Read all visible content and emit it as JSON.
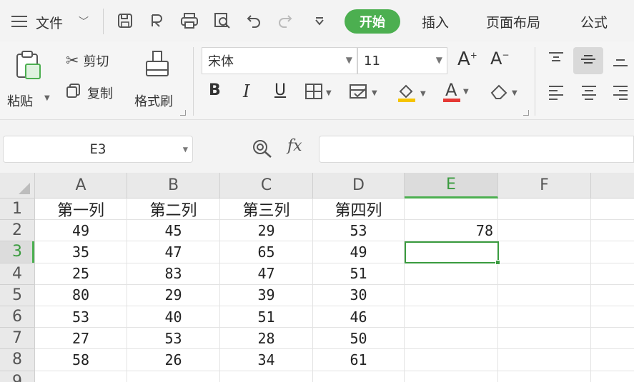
{
  "menubar": {
    "file_label": "文件",
    "active_tab": "开始",
    "tabs": [
      "插入",
      "页面布局",
      "公式"
    ]
  },
  "ribbon": {
    "paste_label": "粘贴",
    "cut_label": "剪切",
    "copy_label": "复制",
    "format_painter_label": "格式刷",
    "font_name": "宋体",
    "font_size": "11",
    "bold": "B",
    "italic": "I",
    "underline": "U",
    "font_color_letter": "A",
    "font_color": "#e53935",
    "fill_color": "#f5c400"
  },
  "formula_bar": {
    "name_box": "E3",
    "fx_label": "fx",
    "formula": ""
  },
  "sheet": {
    "columns": [
      "A",
      "B",
      "C",
      "D",
      "E",
      "F"
    ],
    "rows": [
      "1",
      "2",
      "3",
      "4",
      "5",
      "6",
      "7",
      "8",
      "9"
    ],
    "active_cell": "E3",
    "cells": [
      [
        "第一列",
        "第二列",
        "第三列",
        "第四列",
        "",
        ""
      ],
      [
        "49",
        "45",
        "29",
        "53",
        "78",
        ""
      ],
      [
        "35",
        "47",
        "65",
        "49",
        "",
        ""
      ],
      [
        "25",
        "83",
        "47",
        "51",
        "",
        ""
      ],
      [
        "80",
        "29",
        "39",
        "30",
        "",
        ""
      ],
      [
        "53",
        "40",
        "51",
        "46",
        "",
        ""
      ],
      [
        "27",
        "53",
        "28",
        "50",
        "",
        ""
      ],
      [
        "58",
        "26",
        "34",
        "61",
        "",
        ""
      ],
      [
        "",
        "",
        "",
        "",
        "",
        ""
      ]
    ]
  },
  "colors": {
    "accent": "#4caf50",
    "selection": "#3a9b3f"
  }
}
